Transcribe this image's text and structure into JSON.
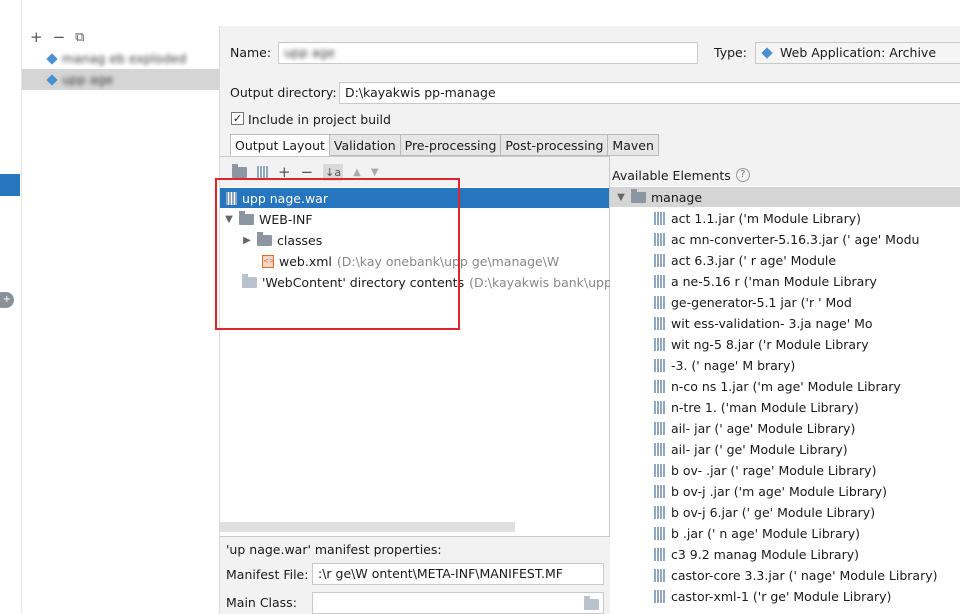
{
  "artifacts": {
    "toolbar": {
      "add": "+",
      "remove": "−",
      "copy": "⧉"
    },
    "items": [
      {
        "label": "manag      eb exploded",
        "active": false
      },
      {
        "label": "upp      age",
        "active": true
      }
    ]
  },
  "form": {
    "name_label": "Name:",
    "name_value": "upp      age",
    "type_label": "Type:",
    "type_value": "Web Application: Archive",
    "output_dir_label": "Output directory:",
    "output_dir_value": "D:\\kayakwis                                                        pp-manage",
    "include_build_label": "Include in project build",
    "include_build_checked": true
  },
  "tabs": [
    {
      "label": "Output Layout",
      "active": true
    },
    {
      "label": "Validation",
      "active": false
    },
    {
      "label": "Pre-processing",
      "active": false
    },
    {
      "label": "Post-processing",
      "active": false
    },
    {
      "label": "Maven",
      "active": false
    }
  ],
  "layout_toolbar": {
    "add": "+",
    "remove": "−",
    "sort": "↓a",
    "up": "▲",
    "down": "▼"
  },
  "layout_tree": {
    "war": "upp      nage.war",
    "web_inf": "WEB-INF",
    "classes": "classes",
    "web_xml": "web.xml",
    "web_xml_path": "(D:\\kay          onebank\\upp        ge\\manage\\W",
    "web_content": "'WebContent' directory contents",
    "web_content_path": "(D:\\kayakwis          bank\\upp"
  },
  "manifest": {
    "title": "'up      nage.war' manifest properties:",
    "file_label": "Manifest File:",
    "file_value": ":\\r       ge\\W        ontent\\META-INF\\MANIFEST.MF",
    "main_class_label": "Main Class:",
    "main_class_value": ""
  },
  "available": {
    "title": "Available Elements",
    "help": "?",
    "root": "manage",
    "libraries": [
      "act       1.1.jar ('m         Module Library)",
      "ac       mn-converter-5.16.3.jar (' age' Modu",
      "act           6.3.jar (' r      age' Module",
      "a          ne-5.16       r ('man      Module Library",
      "        ge-generator-5.1     jar ('r     ' Mod",
      "wit      ess-validation-      3.ja    nage' Mo",
      "wit      ng-5      8.jar ('r     Module Library",
      "     -3.       (' nage' M      brary)",
      "      n-co       ns     1.jar ('m     age' Module Library",
      "      n-tre      1.      ('man      Module Library)",
      "       ail-         jar ('   age' Module Library)",
      "       ail-         jar ('    ge' Module Library)",
      "b      ov-           .jar (' rage' Module Library)",
      "b      ov-j           .jar ('m  age' Module Library)",
      "b      ov-j         6.jar ('     ge' Module Library)",
      "b            .jar (' n    age' Module Library)",
      "c3        9.2      manag     Module Library)",
      "castor-core      3.3.jar ('   nage' Module Library)",
      "castor-xml-1      ('r    ge' Module Library)"
    ]
  }
}
